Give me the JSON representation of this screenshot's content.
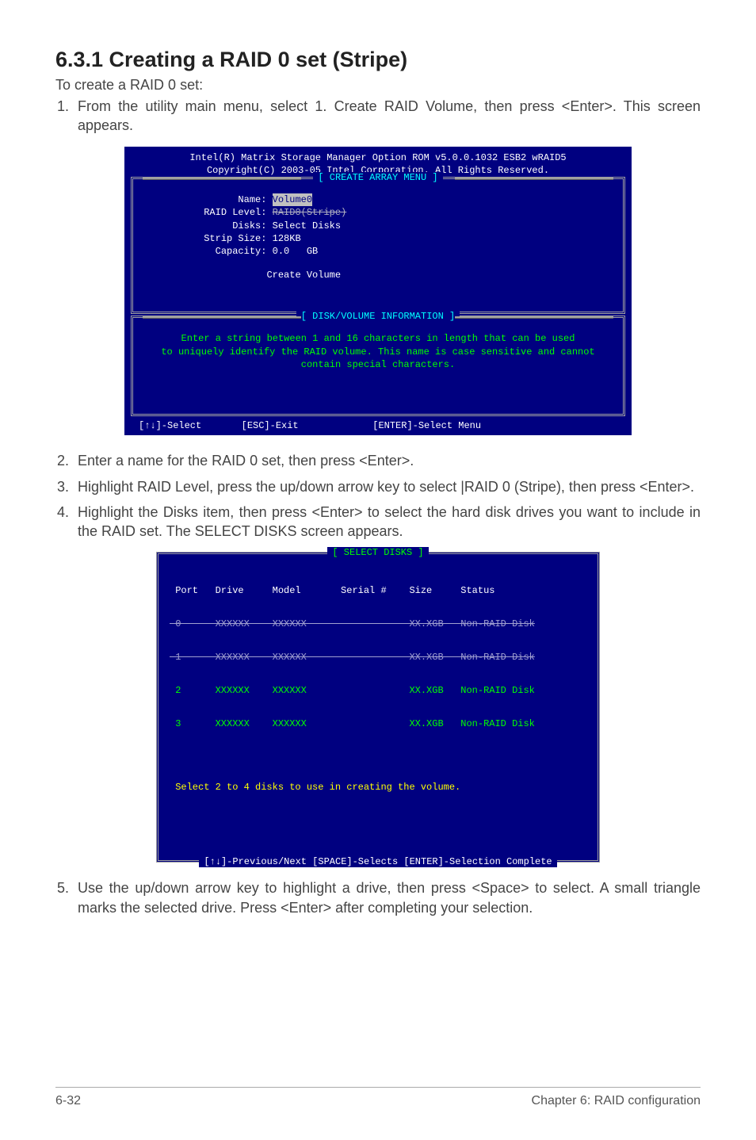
{
  "heading": "6.3.1 Creating a RAID 0 set (Stripe)",
  "intro": "To create a RAID 0 set:",
  "steps": {
    "s1": "From the utility main menu, select 1. Create RAID Volume, then press <Enter>. This screen appears.",
    "s2": "Enter a name for the RAID 0 set, then press <Enter>.",
    "s3": "Highlight RAID Level, press the up/down arrow key to select |RAID 0 (Stripe), then press <Enter>.",
    "s4": "Highlight the Disks item, then press <Enter> to select the hard disk drives you want to include in the RAID set. The SELECT DISKS screen appears.",
    "s5": "Use the up/down arrow key to highlight a drive, then press <Space> to select. A small triangle marks the selected drive. Press <Enter> after completing your selection."
  },
  "bios": {
    "header1": "Intel(R) Matrix Storage Manager Option ROM v5.0.0.1032 ESB2 wRAID5",
    "header2": "Copyright(C) 2003-05 Intel Corporation. All Rights Reserved.",
    "menu_title": "[ CREATE ARRAY MENU ]",
    "labels": {
      "name": "Name:",
      "raid_level": "RAID Level:",
      "disks": "Disks:",
      "strip_size": "Strip Size:",
      "capacity": "Capacity:"
    },
    "values": {
      "name": "Volume0",
      "raid_level": "RAID0(Stripe)",
      "disks": "Select Disks",
      "strip_size": "128KB",
      "capacity": "0.0   GB"
    },
    "create_volume": "Create Volume",
    "info_title": "[ DISK/VOLUME INFORMATION ]",
    "help1": "Enter a string between 1 and 16 characters in length that can be used",
    "help2": "to uniquely identify the RAID volume. This name is case sensitive and cannot",
    "help3": "contain special characters.",
    "footer": "[↑↓]-Select       [ESC]-Exit             [ENTER]-Select Menu"
  },
  "select_disks": {
    "title": "[ SELECT DISKS ]",
    "header": " Port   Drive     Model       Serial #    Size     Status",
    "row0": " 0      XXXXXX    XXXXXX                  XX.XGB   Non-RAID Disk",
    "row1": " 1      XXXXXX    XXXXXX                  XX.XGB   Non-RAID Disk",
    "row2": " 2      XXXXXX    XXXXXX                  XX.XGB   Non-RAID Disk",
    "row3": " 3      XXXXXX    XXXXXX                  XX.XGB   Non-RAID Disk",
    "note": " Select 2 to 4 disks to use in creating the volume.",
    "footer": "[↑↓]-Previous/Next  [SPACE]-Selects  [ENTER]-Selection Complete"
  },
  "page_footer": {
    "left": "6-32",
    "right": "Chapter 6: RAID configuration"
  }
}
